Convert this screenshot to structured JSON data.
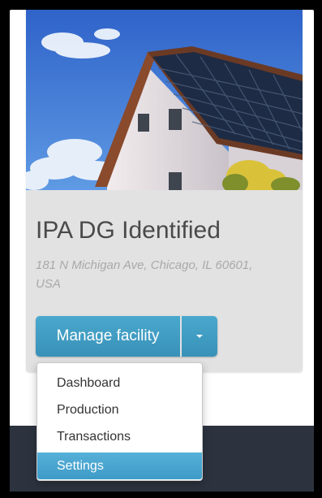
{
  "facility": {
    "name": "IPA DG Identified",
    "address": "181 N Michigan Ave, Chicago, IL 60601, USA",
    "photo_icon": "house-solar-panels-photo"
  },
  "actions": {
    "manage_label": "Manage facility",
    "toggle_icon": "caret-down-icon"
  },
  "menu": {
    "items": [
      {
        "label": "Dashboard"
      },
      {
        "label": "Production"
      },
      {
        "label": "Transactions"
      },
      {
        "label": "Settings",
        "active": true
      }
    ]
  },
  "colors": {
    "accent": "#3e9bc7",
    "footer": "#2c333f",
    "card": "#e2e2e2"
  }
}
